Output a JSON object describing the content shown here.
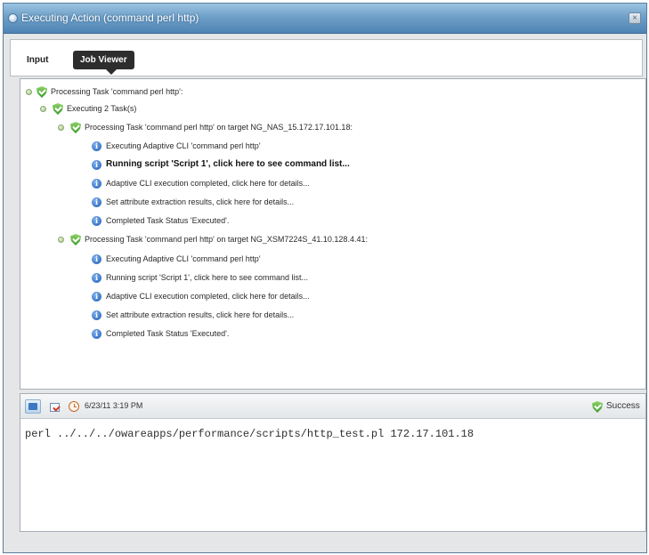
{
  "window": {
    "title": "Executing Action (command perl http)",
    "close_glyph": "×",
    "title_icon": "app-globe-icon"
  },
  "tabs": [
    {
      "label": "Input",
      "active": false
    },
    {
      "label": "Job Viewer",
      "active": true
    }
  ],
  "tree": [
    {
      "text": "Processing Task 'command perl http':",
      "icon": "success-shield-icon",
      "expander": true,
      "bold": false
    },
    {
      "text": "Executing 2 Task(s)",
      "icon": "success-shield-icon",
      "expander": true,
      "bold": false
    },
    {
      "text": "Processing Task 'command perl http' on target NG_NAS_15.172.17.101.18:",
      "icon": "success-shield-icon",
      "expander": true,
      "bold": false
    },
    {
      "text": "Executing Adaptive CLI 'command perl http'",
      "icon": "info-icon",
      "expander": false,
      "bold": false
    },
    {
      "text": "Running script 'Script 1', click here to see command list...",
      "icon": "info-icon",
      "expander": false,
      "bold": true
    },
    {
      "text": "Adaptive CLI execution completed, click here for details...",
      "icon": "info-icon",
      "expander": false,
      "bold": false
    },
    {
      "text": "Set attribute extraction results, click here for details...",
      "icon": "info-icon",
      "expander": false,
      "bold": false
    },
    {
      "text": "Completed Task Status 'Executed'.",
      "icon": "info-icon",
      "expander": false,
      "bold": false
    },
    {
      "text": "Processing Task 'command perl http' on target NG_XSM7224S_41.10.128.4.41:",
      "icon": "success-shield-icon",
      "expander": true,
      "bold": false
    },
    {
      "text": "Executing Adaptive CLI 'command perl http'",
      "icon": "info-icon",
      "expander": false,
      "bold": false
    },
    {
      "text": "Running script 'Script 1', click here to see command list...",
      "icon": "info-icon",
      "expander": false,
      "bold": false
    },
    {
      "text": "Adaptive CLI execution completed, click here for details...",
      "icon": "info-icon",
      "expander": false,
      "bold": false
    },
    {
      "text": "Set attribute extraction results, click here for details...",
      "icon": "info-icon",
      "expander": false,
      "bold": false
    },
    {
      "text": "Completed Task Status 'Executed'.",
      "icon": "info-icon",
      "expander": false,
      "bold": false
    }
  ],
  "bottom": {
    "toolbar_icons": [
      "refresh-icon",
      "export-icon"
    ],
    "clock_icon": "clock-icon",
    "timestamp": "6/23/11 3:19 PM",
    "status": "Success",
    "status_icon": "success-shield-icon",
    "command": "perl ../../../owareapps/performance/scripts/http_test.pl 172.17.101.18"
  },
  "colors": {
    "titlebar": "#6e9fc7",
    "success_green": "#3c9a2c",
    "info_blue": "#1f5fb5",
    "active_tab": "#2d2d2d"
  }
}
